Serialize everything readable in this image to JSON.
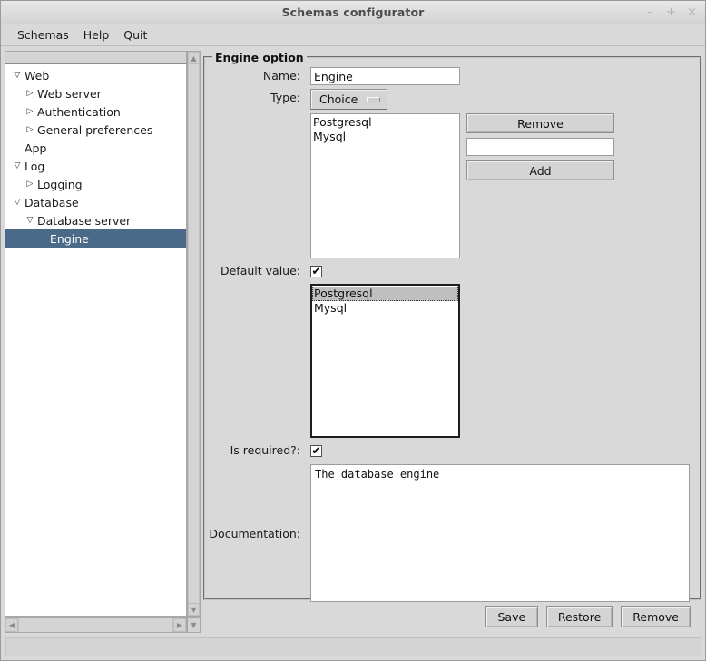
{
  "window": {
    "title": "Schemas configurator",
    "controls": [
      {
        "name": "minimize",
        "glyph": "–"
      },
      {
        "name": "maximize",
        "glyph": "+"
      },
      {
        "name": "close",
        "glyph": "×"
      }
    ]
  },
  "menubar": {
    "items": [
      {
        "label": "Schemas"
      },
      {
        "label": "Help"
      },
      {
        "label": "Quit"
      }
    ]
  },
  "tree": {
    "items": [
      {
        "label": "Web",
        "indent": 0,
        "twisty": "open",
        "selected": false
      },
      {
        "label": "Web server",
        "indent": 1,
        "twisty": "closed",
        "selected": false
      },
      {
        "label": "Authentication",
        "indent": 1,
        "twisty": "closed",
        "selected": false
      },
      {
        "label": "General preferences",
        "indent": 1,
        "twisty": "closed",
        "selected": false
      },
      {
        "label": "App",
        "indent": 0,
        "twisty": "none",
        "selected": false
      },
      {
        "label": "Log",
        "indent": 0,
        "twisty": "open",
        "selected": false
      },
      {
        "label": "Logging",
        "indent": 1,
        "twisty": "closed",
        "selected": false
      },
      {
        "label": "Database",
        "indent": 0,
        "twisty": "open",
        "selected": false
      },
      {
        "label": "Database server",
        "indent": 1,
        "twisty": "open",
        "selected": false
      },
      {
        "label": "Engine",
        "indent": 2,
        "twisty": "none",
        "selected": true
      }
    ],
    "selection_color": "#4b6a8a"
  },
  "panel": {
    "title": "Engine option",
    "name_label": "Name:",
    "name_value": "Engine",
    "type_label": "Type:",
    "type_value": "Choice",
    "choices": [
      {
        "label": "Postgresql",
        "selected": false
      },
      {
        "label": "Mysql",
        "selected": false
      }
    ],
    "remove_label": "Remove",
    "add_value": "",
    "add_label": "Add",
    "default_value_label": "Default value:",
    "default_value_checked": "✔",
    "default_values": [
      {
        "label": "Postgresql",
        "selected": true
      },
      {
        "label": "Mysql",
        "selected": false
      }
    ],
    "is_required_label": "Is required?:",
    "is_required_checked": "✔",
    "documentation_label": "Documentation:",
    "documentation_value": "The database engine"
  },
  "footer": {
    "save_label": "Save",
    "restore_label": "Restore",
    "remove_label": "Remove"
  },
  "scrollbars": {
    "up_glyph": "▲",
    "down_glyph": "▼",
    "left_glyph": "◀",
    "right_glyph": "▶"
  }
}
